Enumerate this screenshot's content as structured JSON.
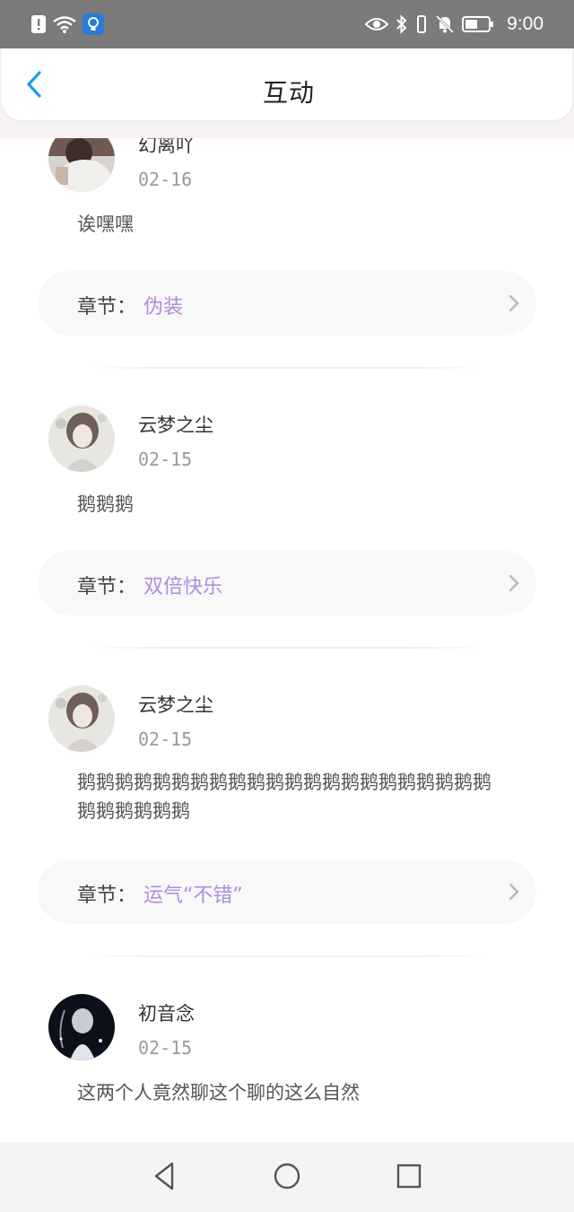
{
  "status_bar": {
    "time": "9:00",
    "left_icons": [
      "alert-icon",
      "wifi-icon",
      "bulb-app-icon"
    ],
    "right_icons": [
      "eye-icon",
      "bluetooth-icon",
      "vibrate-icon",
      "mute-bell-icon",
      "battery-icon"
    ]
  },
  "header": {
    "title": "互动",
    "back_icon": "chevron-left-icon",
    "accent": "#1f9ee8"
  },
  "posts": [
    {
      "author": "幻离吖",
      "date": "02-16",
      "text": "诶嘿嘿",
      "chapter_prefix": "章节：",
      "chapter_name": "伪装"
    },
    {
      "author": "云梦之尘",
      "date": "02-15",
      "text": "鹅鹅鹅",
      "chapter_prefix": "章节：",
      "chapter_name": "双倍快乐"
    },
    {
      "author": "云梦之尘",
      "date": "02-15",
      "text": "鹅鹅鹅鹅鹅鹅鹅鹅鹅鹅鹅鹅鹅鹅鹅鹅鹅鹅鹅鹅鹅鹅鹅鹅鹅鹅鹅鹅",
      "chapter_prefix": "章节：",
      "chapter_name": "运气“不错”"
    },
    {
      "author": "初音念",
      "date": "02-15",
      "text": "这两个人竟然聊这个聊的这么自然"
    }
  ],
  "colors": {
    "chapter_link": "#b08dd8",
    "status_bar_bg": "#7b7b7b"
  },
  "nav_bar": {
    "back": "triangle-back-icon",
    "home": "circle-home-icon",
    "recents": "square-recents-icon"
  }
}
